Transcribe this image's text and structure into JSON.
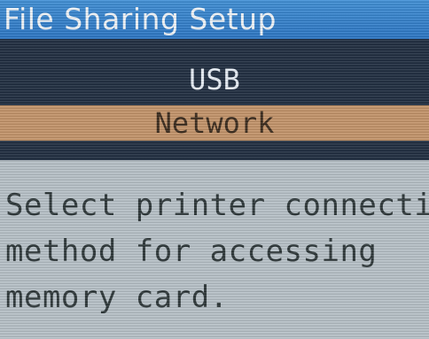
{
  "header": {
    "title": "File Sharing Setup"
  },
  "menu": {
    "items": [
      {
        "label": "USB",
        "selected": false
      },
      {
        "label": "Network",
        "selected": true
      }
    ]
  },
  "description": {
    "lines": [
      "Select printer connection",
      "method for accessing",
      "memory card."
    ]
  },
  "colors": {
    "title_bar": "#2a75c4",
    "menu_background": "#1f2d40",
    "selected_highlight": "#c4946a",
    "screen_background": "#b8c2c8"
  }
}
